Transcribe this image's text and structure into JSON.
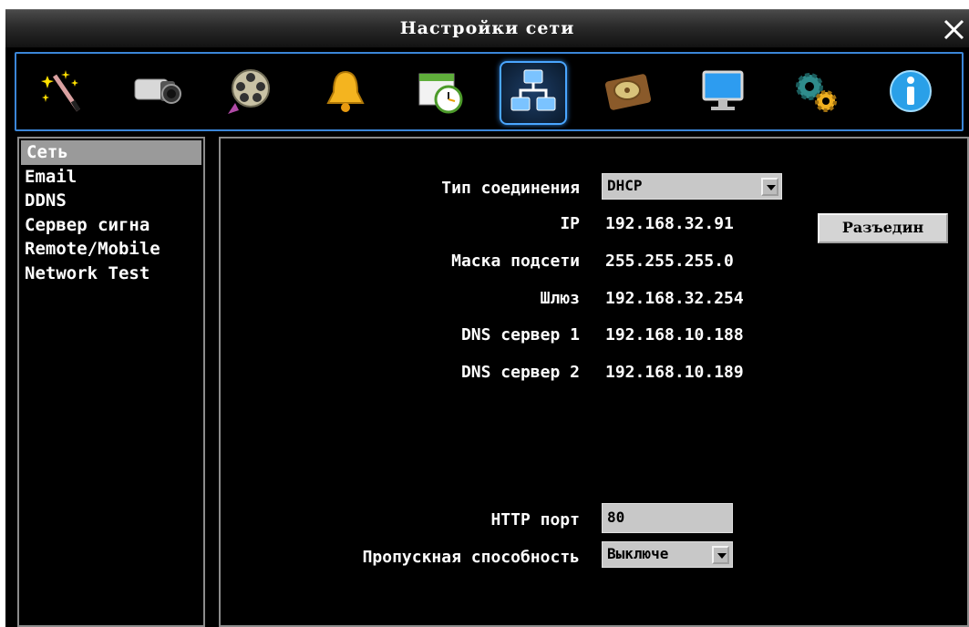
{
  "window": {
    "title": "Настройки сети"
  },
  "toolbar": {
    "icons": [
      {
        "name": "wizard-wand-icon"
      },
      {
        "name": "camera-icon"
      },
      {
        "name": "film-reel-icon"
      },
      {
        "name": "alarm-bell-icon"
      },
      {
        "name": "schedule-clock-icon"
      },
      {
        "name": "network-icon",
        "active": true
      },
      {
        "name": "hard-disk-icon"
      },
      {
        "name": "monitor-icon"
      },
      {
        "name": "gears-icon"
      },
      {
        "name": "info-icon"
      }
    ]
  },
  "sidebar": {
    "items": [
      {
        "label": "Сеть",
        "selected": true
      },
      {
        "label": "Email"
      },
      {
        "label": "DDNS"
      },
      {
        "label": "Сервер сигна"
      },
      {
        "label": "Remote/Mobile"
      },
      {
        "label": "Network Test"
      }
    ]
  },
  "network": {
    "connection_type_label": "Тип соединения",
    "connection_type_value": "DHCP",
    "ip_label": "IP",
    "ip_value": "192.168.32.91",
    "disconnect_label": "Разъедин",
    "mask_label": "Маска подсети",
    "mask_value": "255.255.255.0",
    "gateway_label": "Шлюз",
    "gateway_value": "192.168.32.254",
    "dns1_label": "DNS сервер 1",
    "dns1_value": "192.168.10.188",
    "dns2_label": "DNS сервер 2",
    "dns2_value": "192.168.10.189",
    "http_port_label": "HTTP порт",
    "http_port_value": "80",
    "bandwidth_label": "Пропускная способность",
    "bandwidth_value": "Выключе"
  },
  "colors": {
    "toolbar_border": "#3b86d8",
    "active_tab_glow": "#4aa6ff",
    "panel_border": "#8c8c8c",
    "input_bg": "#c8c8c8"
  }
}
